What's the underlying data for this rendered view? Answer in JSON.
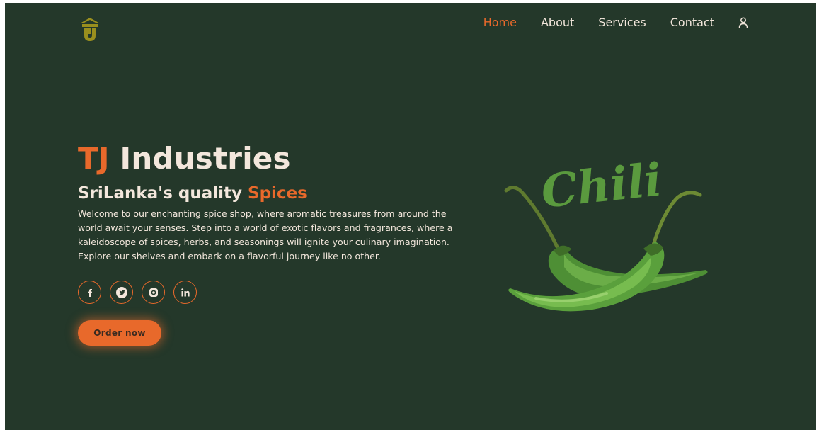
{
  "nav": {
    "items": [
      {
        "label": "Home",
        "active": true
      },
      {
        "label": "About",
        "active": false
      },
      {
        "label": "Services",
        "active": false
      },
      {
        "label": "Contact",
        "active": false
      }
    ],
    "user_icon": "user-icon"
  },
  "hero": {
    "title_accent": "TJ",
    "title_rest": " Industries",
    "subtitle_main": "SriLanka's quality ",
    "subtitle_accent": "Spices",
    "description": "Welcome to our enchanting spice shop, where aromatic treasures from around the world await your senses. Step into a world of exotic flavors and fragrances, where a kaleidoscope of spices, herbs, and seasonings will ignite your culinary imagination. Explore our shelves and embark on a flavorful journey like no other.",
    "order_label": "Order now",
    "art_text": "Chili"
  },
  "socials": [
    {
      "icon": "facebook-icon"
    },
    {
      "icon": "twitter-icon"
    },
    {
      "icon": "instagram-icon"
    },
    {
      "icon": "linkedin-icon"
    }
  ],
  "colors": {
    "background": "#24382a",
    "accent": "#e8692b",
    "text": "#f3e7dc",
    "chili_green": "#5a9a3e"
  }
}
